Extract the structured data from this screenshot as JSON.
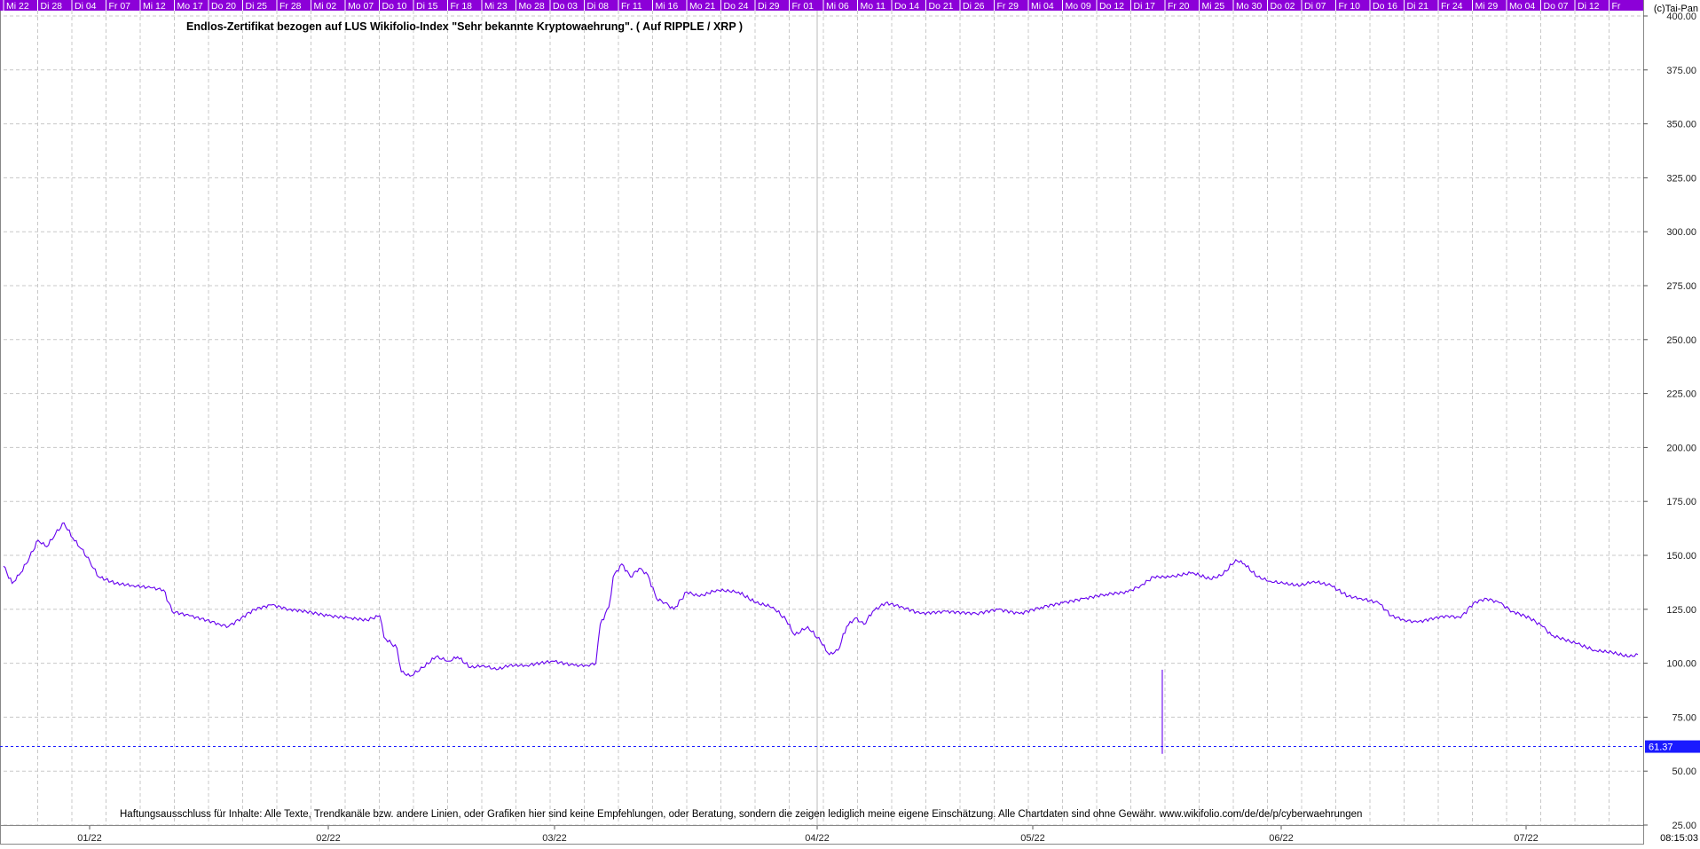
{
  "copyright": "(c)Tai-Pan",
  "clock": "08:15:03",
  "colors": {
    "background": "#ffffff",
    "line": "#6600ee",
    "grid": "#c8c8c8",
    "top_bar": "#8c00d8",
    "top_bar_text": "#ffffff",
    "last_value_bg": "#1a1aff",
    "last_value_text": "#ffffff"
  },
  "chart_data": {
    "type": "line",
    "title": "Endlos-Zertifikat bezogen auf LUS Wikifolio-Index \"Sehr bekannte Kryptowaehrung\". ( Auf RIPPLE / XRP )",
    "footnote": "Haftungsausschluss für Inhalte: Alle Texte, Trendkanäle bzw. andere Linien, oder Grafiken hier sind keine Empfehlungen, oder Beratung, sondern die zeigen lediglich meine eigene Einschätzung. Alle Chartdaten sind ohne Gewähr.  www.wikifolio.com/de/de/p/cyberwaehrungen",
    "xlabel": "",
    "ylabel": "",
    "ylim": [
      25,
      400
    ],
    "y_ticks": [
      "400.00",
      "375.00",
      "350.00",
      "325.00",
      "300.00",
      "275.00",
      "250.00",
      "225.00",
      "200.00",
      "175.00",
      "150.00",
      "125.00",
      "100.00",
      "75.00",
      "50.00",
      "25.00"
    ],
    "x_month_labels": [
      "01/22",
      "02/22",
      "03/22",
      "04/22",
      "05/22",
      "06/22",
      "07/22"
    ],
    "day_labels": [
      "Mi 22",
      "Di 28",
      "Di 04",
      "Fr 07",
      "Mi 12",
      "Mo 17",
      "Do 20",
      "Di 25",
      "Fr 28",
      "Mi 02",
      "Mo 07",
      "Do 10",
      "Di 15",
      "Fr 18",
      "Mi 23",
      "Mo 28",
      "Do 03",
      "Di 08",
      "Fr 11",
      "Mi 16",
      "Mo 21",
      "Do 24",
      "Di 29",
      "Fr 01",
      "Mi 06",
      "Mo 11",
      "Do 14",
      "Do 21",
      "Di 26",
      "Fr 29",
      "Mi 04",
      "Mo 09",
      "Do 12",
      "Di 17",
      "Fr 20",
      "Mi 25",
      "Mo 30",
      "Do 02",
      "Di 07",
      "Fr 10",
      "Do 16",
      "Di 21",
      "Fr 24",
      "Mi 29",
      "Mo 04",
      "Do 07",
      "Di 12",
      "Fr"
    ],
    "last_value": "61.37",
    "grid": true,
    "x_range": [
      0,
      378
    ],
    "series": [
      {
        "values": [
          [
            0,
            145
          ],
          [
            2,
            137
          ],
          [
            4,
            142
          ],
          [
            6,
            149
          ],
          [
            8,
            157
          ],
          [
            10,
            154
          ],
          [
            12,
            160
          ],
          [
            14,
            165
          ],
          [
            16,
            158
          ],
          [
            18,
            153
          ],
          [
            20,
            147
          ],
          [
            22,
            140
          ],
          [
            26,
            137
          ],
          [
            30,
            136
          ],
          [
            34,
            135
          ],
          [
            37,
            134
          ],
          [
            39,
            124
          ],
          [
            43,
            122
          ],
          [
            47,
            120
          ],
          [
            50,
            118
          ],
          [
            52,
            117
          ],
          [
            55,
            121
          ],
          [
            58,
            125
          ],
          [
            62,
            127
          ],
          [
            66,
            125
          ],
          [
            70,
            124
          ],
          [
            75,
            122
          ],
          [
            80,
            121
          ],
          [
            84,
            120
          ],
          [
            87,
            122
          ],
          [
            88,
            112
          ],
          [
            91,
            107
          ],
          [
            92,
            96
          ],
          [
            94,
            94
          ],
          [
            97,
            98
          ],
          [
            100,
            103
          ],
          [
            103,
            101
          ],
          [
            105,
            103
          ],
          [
            108,
            98
          ],
          [
            111,
            99
          ],
          [
            114,
            97
          ],
          [
            117,
            99
          ],
          [
            121,
            99
          ],
          [
            127,
            101
          ],
          [
            132,
            99
          ],
          [
            135,
            99
          ],
          [
            137,
            100
          ],
          [
            138,
            118
          ],
          [
            140,
            126
          ],
          [
            141,
            140
          ],
          [
            143,
            146
          ],
          [
            145,
            140
          ],
          [
            147,
            144
          ],
          [
            149,
            141
          ],
          [
            151,
            130
          ],
          [
            153,
            128
          ],
          [
            155,
            125
          ],
          [
            158,
            133
          ],
          [
            161,
            131
          ],
          [
            165,
            134
          ],
          [
            170,
            133
          ],
          [
            174,
            128
          ],
          [
            178,
            126
          ],
          [
            181,
            120
          ],
          [
            183,
            113
          ],
          [
            186,
            117
          ],
          [
            189,
            110
          ],
          [
            191,
            104
          ],
          [
            193,
            106
          ],
          [
            195,
            117
          ],
          [
            197,
            121
          ],
          [
            199,
            118
          ],
          [
            201,
            124
          ],
          [
            204,
            128
          ],
          [
            208,
            126
          ],
          [
            212,
            123
          ],
          [
            218,
            124
          ],
          [
            225,
            123
          ],
          [
            230,
            125
          ],
          [
            235,
            123
          ],
          [
            240,
            126
          ],
          [
            245,
            128
          ],
          [
            250,
            130
          ],
          [
            255,
            132
          ],
          [
            260,
            133
          ],
          [
            263,
            136
          ],
          [
            266,
            140
          ],
          [
            270,
            140
          ],
          [
            275,
            142
          ],
          [
            279,
            139
          ],
          [
            282,
            141
          ],
          [
            285,
            148
          ],
          [
            287,
            146
          ],
          [
            290,
            140
          ],
          [
            293,
            138
          ],
          [
            296,
            137
          ],
          [
            300,
            136
          ],
          [
            303,
            138
          ],
          [
            307,
            136
          ],
          [
            311,
            131
          ],
          [
            314,
            130
          ],
          [
            318,
            128
          ],
          [
            321,
            122
          ],
          [
            324,
            120
          ],
          [
            327,
            119
          ],
          [
            331,
            121
          ],
          [
            334,
            122
          ],
          [
            337,
            121
          ],
          [
            340,
            128
          ],
          [
            343,
            130
          ],
          [
            346,
            128
          ],
          [
            349,
            124
          ],
          [
            353,
            121
          ],
          [
            356,
            117
          ],
          [
            358,
            113
          ],
          [
            361,
            111
          ],
          [
            364,
            109
          ],
          [
            368,
            106
          ],
          [
            372,
            105
          ],
          [
            376,
            103
          ],
          [
            378,
            104
          ]
        ],
        "note_index": "x is sequential trading-day index across the visible range"
      }
    ]
  }
}
